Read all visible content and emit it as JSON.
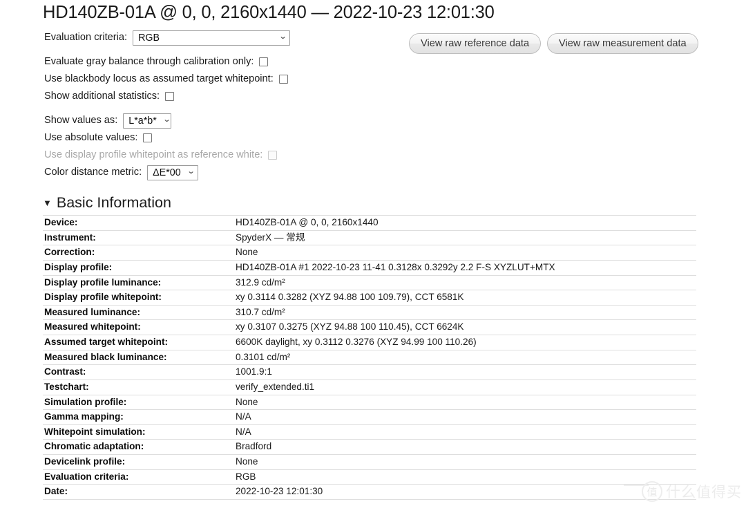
{
  "title": "HD140ZB-01A @ 0, 0, 2160x1440 — 2022-10-23 12:01:30",
  "options": {
    "evaluation_criteria_label": "Evaluation criteria:",
    "evaluation_criteria_value": "RGB",
    "gray_balance_label": "Evaluate gray balance through calibration only:",
    "blackbody_label": "Use blackbody locus as assumed target whitepoint:",
    "additional_stats_label": "Show additional statistics:",
    "show_values_as_label": "Show values as:",
    "show_values_as_value": "L*a*b*",
    "absolute_values_label": "Use absolute values:",
    "profile_whitepoint_label": "Use display profile whitepoint as reference white:",
    "color_distance_label": "Color distance metric:",
    "color_distance_value": "ΔE*00"
  },
  "buttons": {
    "view_raw_reference": "View raw reference data",
    "view_raw_measurement": "View raw measurement data"
  },
  "section": {
    "triangle": "▼",
    "basic_information": "Basic Information"
  },
  "basic_information": [
    {
      "key": "Device:",
      "value": "HD140ZB-01A @ 0, 0, 2160x1440"
    },
    {
      "key": "Instrument:",
      "value": "SpyderX — 常规"
    },
    {
      "key": "Correction:",
      "value": "None"
    },
    {
      "key": "Display profile:",
      "value": "HD140ZB-01A #1 2022-10-23 11-41 0.3128x 0.3292y 2.2 F-S XYZLUT+MTX"
    },
    {
      "key": "Display profile luminance:",
      "value": "312.9 cd/m²"
    },
    {
      "key": "Display profile whitepoint:",
      "value": "xy 0.3114 0.3282 (XYZ 94.88 100 109.79), CCT 6581K"
    },
    {
      "key": "Measured luminance:",
      "value": "310.7 cd/m²"
    },
    {
      "key": "Measured whitepoint:",
      "value": "xy 0.3107 0.3275 (XYZ 94.88 100 110.45), CCT 6624K"
    },
    {
      "key": "Assumed target whitepoint:",
      "value": "6600K daylight, xy 0.3112 0.3276 (XYZ 94.99 100 110.26)"
    },
    {
      "key": "Measured black luminance:",
      "value": "0.3101 cd/m²"
    },
    {
      "key": "Contrast:",
      "value": "1001.9:1"
    },
    {
      "key": "Testchart:",
      "value": "verify_extended.ti1"
    },
    {
      "key": "Simulation profile:",
      "value": "None"
    },
    {
      "key": "Gamma mapping:",
      "value": "N/A"
    },
    {
      "key": "Whitepoint simulation:",
      "value": "N/A"
    },
    {
      "key": "Chromatic adaptation:",
      "value": "Bradford"
    },
    {
      "key": "Devicelink profile:",
      "value": "None"
    },
    {
      "key": "Evaluation criteria:",
      "value": "RGB"
    },
    {
      "key": "Date:",
      "value": "2022-10-23 12:01:30"
    }
  ],
  "watermark": {
    "circle_char": "值",
    "text": "什么值得买"
  }
}
